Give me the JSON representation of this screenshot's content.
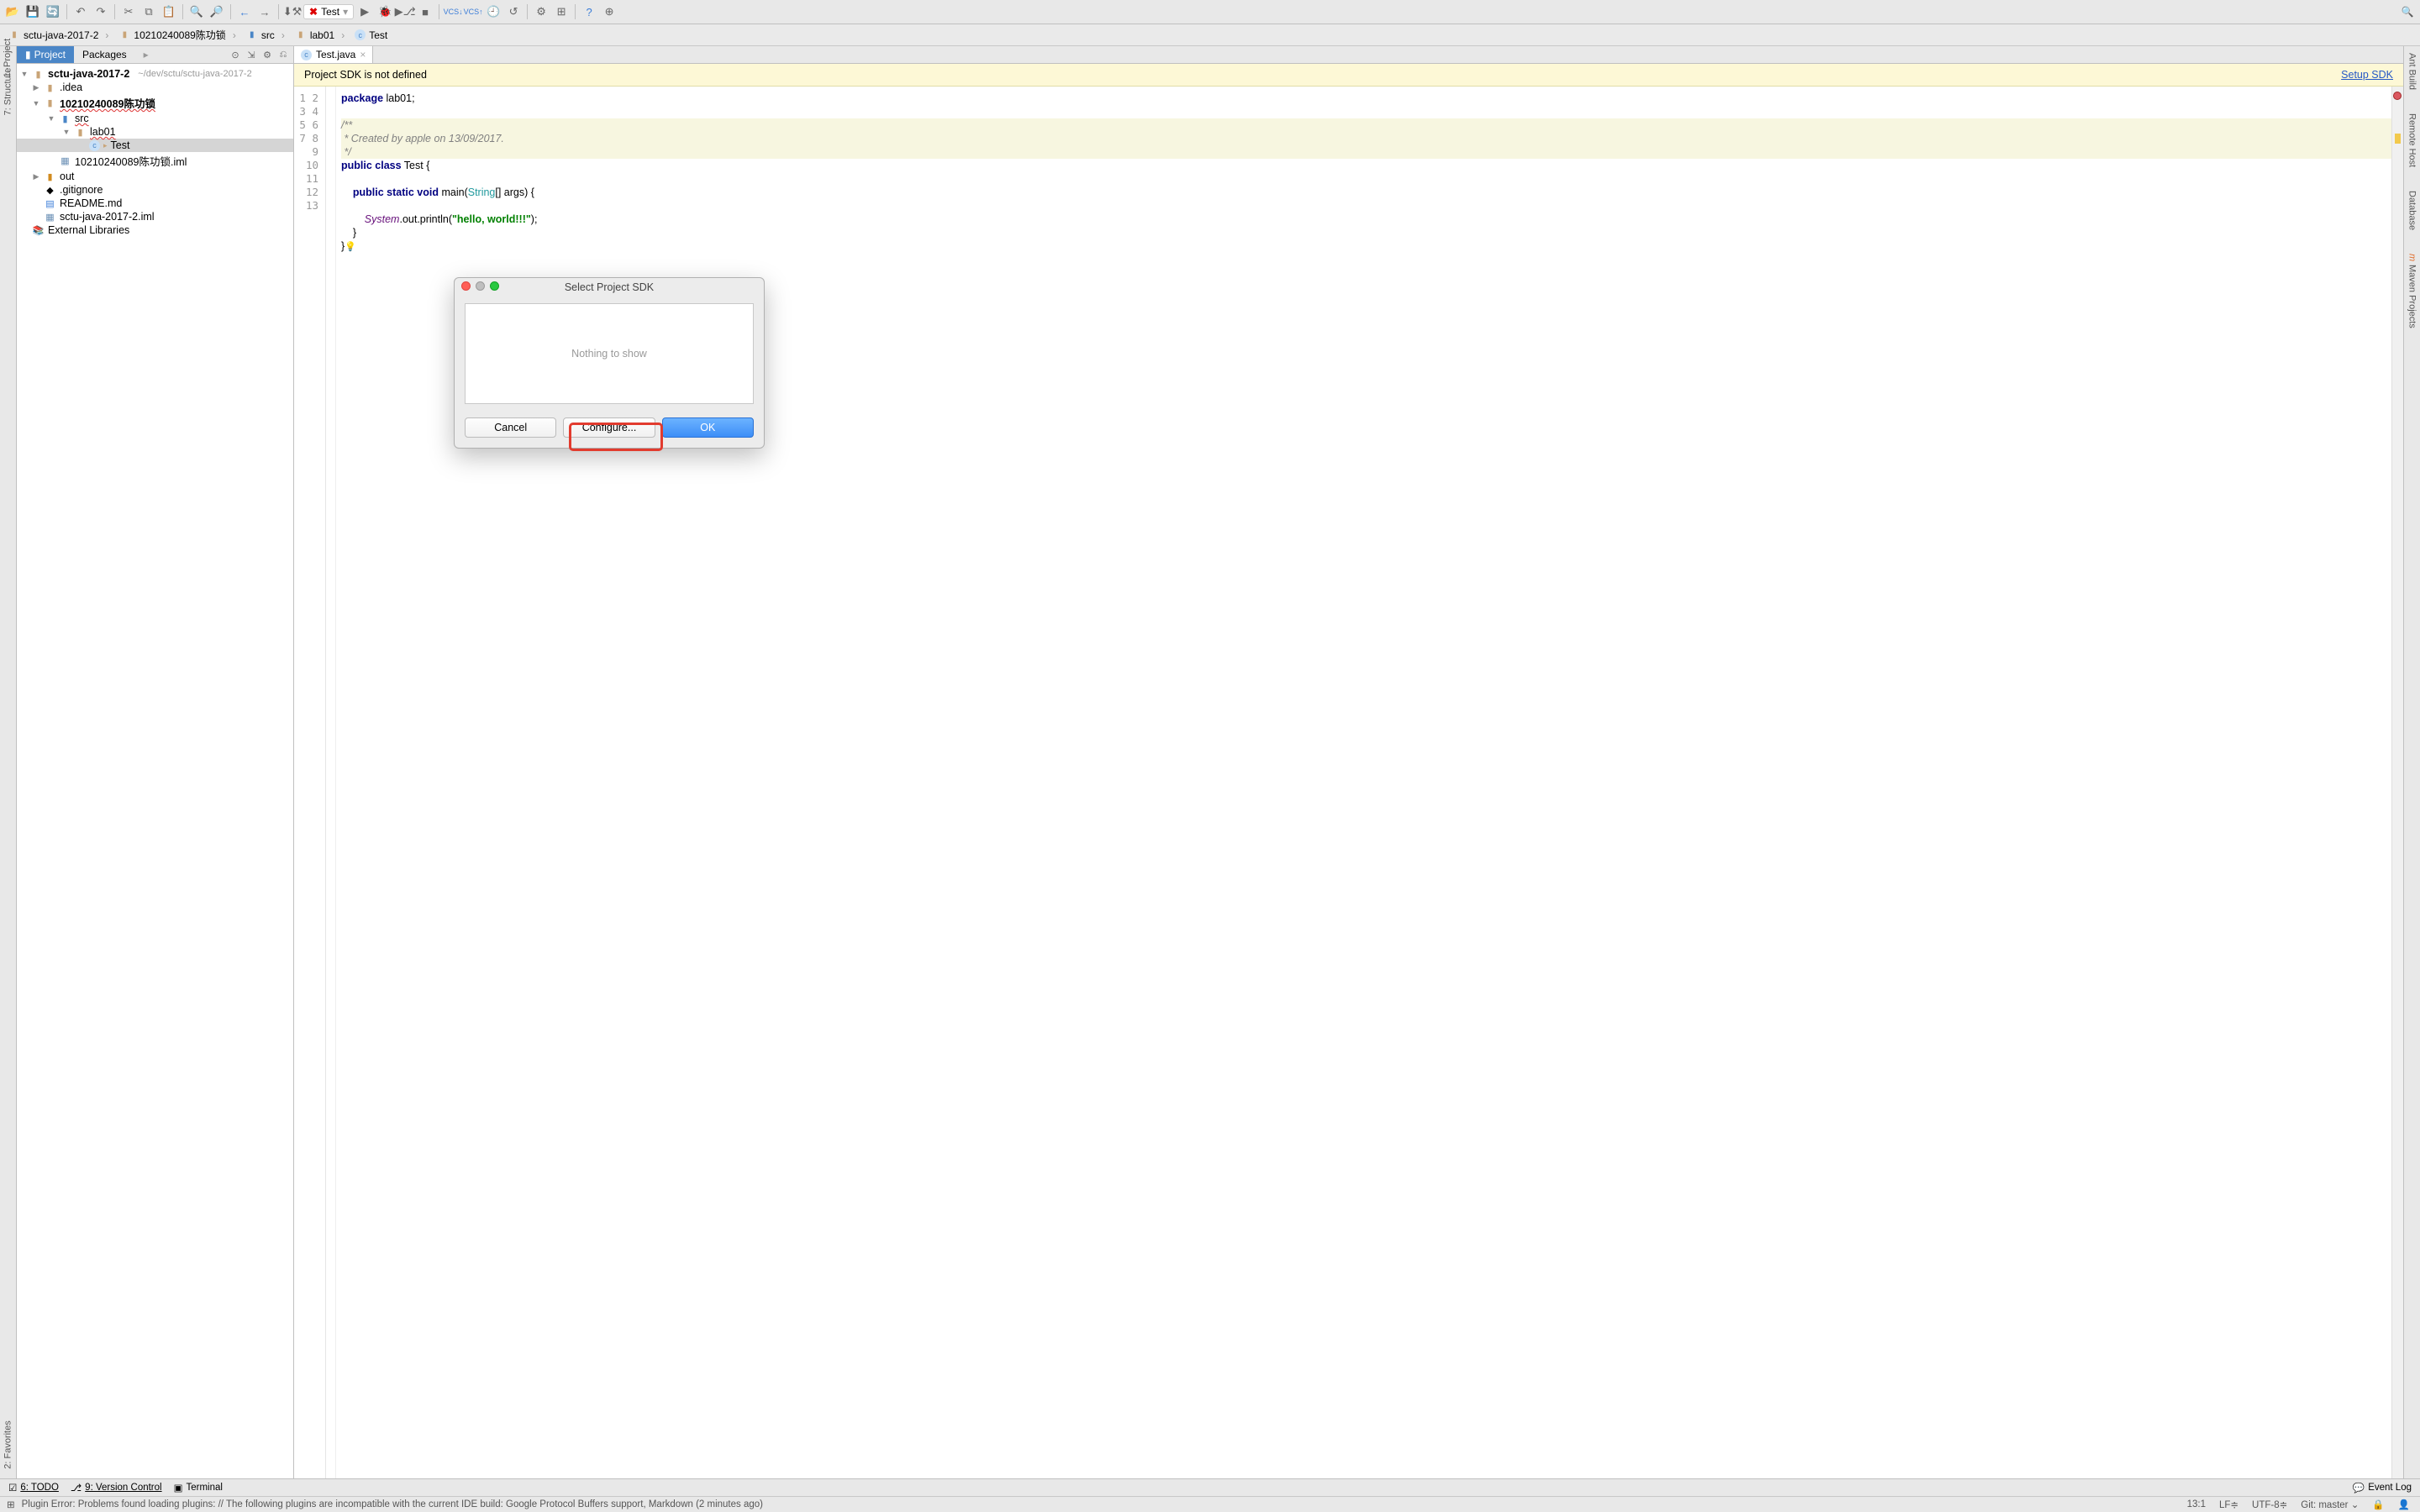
{
  "toolbar": {
    "run_config_label": "Test"
  },
  "breadcrumb": [
    {
      "icon": "folder",
      "label": "sctu-java-2017-2"
    },
    {
      "icon": "folder",
      "label": "10210240089陈功锁"
    },
    {
      "icon": "folder-blue",
      "label": "src"
    },
    {
      "icon": "folder",
      "label": "lab01"
    },
    {
      "icon": "class",
      "label": "Test"
    }
  ],
  "panel": {
    "project_tab": "Project",
    "packages_tab": "Packages"
  },
  "tree": {
    "root": "sctu-java-2017-2",
    "root_path": "~/dev/sctu/sctu-java-2017-2",
    "idea": ".idea",
    "module": "10210240089陈功锁",
    "src": "src",
    "lab01": "lab01",
    "test": "Test",
    "iml": "10210240089陈功锁.iml",
    "out": "out",
    "gitignore": ".gitignore",
    "readme": "README.md",
    "root_iml": "sctu-java-2017-2.iml",
    "ext": "External Libraries"
  },
  "editor": {
    "tab": "Test.java",
    "banner": "Project SDK is not defined",
    "banner_link": "Setup SDK"
  },
  "code": {
    "l1a": "package",
    "l1b": " lab01;",
    "l3": "/**",
    "l4": " * Created by apple on 13/09/2017.",
    "l5": " */",
    "l6a": "public class",
    "l6b": " Test {",
    "l8a": "    public static void",
    "l8b": " main(",
    "l8c": "String",
    "l8d": "[] args) {",
    "l10a": "        System",
    "l10b": ".out.println(",
    "l10c": "\"hello, world!!!\"",
    "l10d": ");",
    "l11": "    }",
    "l12": "}"
  },
  "dialog": {
    "title": "Select Project SDK",
    "empty": "Nothing to show",
    "cancel": "Cancel",
    "configure": "Configure...",
    "ok": "OK"
  },
  "sidebars": {
    "left1": "1: Project",
    "left2": "7: Structure",
    "left3": "2: Favorites",
    "right1": "Ant Build",
    "right2": "Remote Host",
    "right3": "Database",
    "right4": "Maven Projects"
  },
  "bottom": {
    "todo": "6: TODO",
    "vc": "9: Version Control",
    "term": "Terminal",
    "eventlog": "Event Log"
  },
  "status": {
    "msg": "Plugin Error: Problems found loading plugins: // The following plugins are incompatible with the current IDE build: Google Protocol Buffers support, Markdown (2 minutes ago)",
    "pos": "13:1",
    "le": "LF",
    "enc": "UTF-8",
    "git": "Git: master"
  }
}
